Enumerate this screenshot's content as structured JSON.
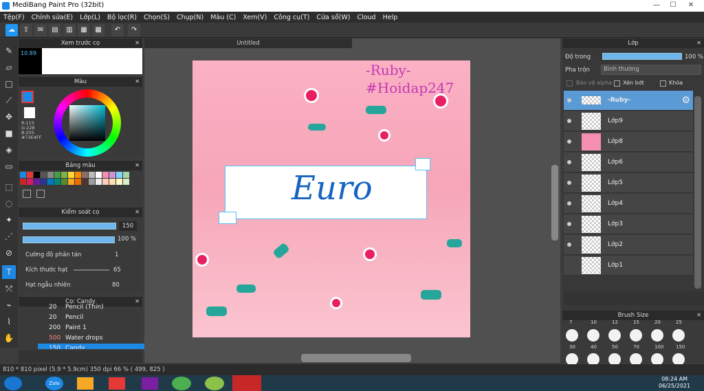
{
  "window": {
    "title": "MediBang Paint Pro (32bit)",
    "min": "—",
    "max": "☐",
    "close": "✕"
  },
  "menu": [
    "Tệp(F)",
    "Chỉnh sửa(E)",
    "Lớp(L)",
    "Bộ lọc(R)",
    "Chọn(S)",
    "Chụp(N)",
    "Màu (C)",
    "Xem(V)",
    "Công cụ(T)",
    "Cửa sổ(W)",
    "Cloud",
    "Help"
  ],
  "brush_preview": {
    "title": "Xem trước cọ",
    "size": "10.89"
  },
  "color_panel": {
    "title": "Màu",
    "r": "R:115",
    "g": "G:228",
    "b": "B:255",
    "hex": "#73E4FF"
  },
  "palette": {
    "title": "Bảng màu",
    "colors": [
      "#1e88e5",
      "#e53935",
      "#000000",
      "#555555",
      "#888888",
      "#43a047",
      "#7cb342",
      "#fdd835",
      "#fb8c00",
      "#8d6e63",
      "#bbbbbb",
      "#ffffff",
      "#f48fb1",
      "#ce93d8",
      "#81d4fa",
      "#a5d6a7",
      "#c62828",
      "#d81b60",
      "#6a1b9a",
      "#283593",
      "#0277bd",
      "#00897b",
      "#558b2f",
      "#f9a825",
      "#ef6c00",
      "#4e342e",
      "#9e9e9e",
      "#eeeeee",
      "#ffccbc",
      "#ffe0b2",
      "#fff9c4",
      "#dcedc8"
    ]
  },
  "brush_control": {
    "title": "Kiểm soát cọ",
    "size": "150",
    "opacity": "100 %",
    "scatter_label": "Cường độ phân tán",
    "scatter_val": "1",
    "grain_label": "Kích thước hạt",
    "grain_val": "65",
    "random_label": "Hạt ngẫu nhiên",
    "random_val": "80"
  },
  "brush_list": {
    "title": "Cọ: Candy",
    "items": [
      {
        "size": "20",
        "name": "Pencil (Thin)"
      },
      {
        "size": "20",
        "name": "Pencil"
      },
      {
        "size": "200",
        "name": "Paint 1"
      },
      {
        "size": "500",
        "name": "Water drops"
      },
      {
        "size": "150",
        "name": "Candy"
      }
    ]
  },
  "document": {
    "tab": "Untitled",
    "canvas_title1": "-Ruby-",
    "canvas_title2": "#Hoidap247",
    "canvas_text": "Euro"
  },
  "layer_panel": {
    "title": "Lớp",
    "opacity_label": "Độ trong",
    "opacity_value": "100 %",
    "blend_label": "Pha trộn",
    "blend_value": "Bình thường",
    "protect_alpha": "Bảo vệ alpha",
    "clipping": "Xén bớt",
    "lock": "Khóa",
    "layers": [
      "-Ruby-",
      "Lớp9",
      "Lớp8",
      "Lớp6",
      "Lớp5",
      "Lớp4",
      "Lớp3",
      "Lớp2",
      "Lớp1"
    ]
  },
  "brush_size": {
    "title": "Brush Size",
    "row1": [
      "7",
      "10",
      "12",
      "15",
      "20",
      "25"
    ],
    "row2": [
      "30",
      "40",
      "50",
      "70",
      "100",
      "150"
    ]
  },
  "status": {
    "text": "810 * 810 pixel   (5.9 * 5.9cm)   350 dpi   66 %   ( 499, 825 )"
  },
  "taskbar": {
    "time": "08:24 AM",
    "date": "06/25/2021",
    "zalo": "Zalo"
  }
}
